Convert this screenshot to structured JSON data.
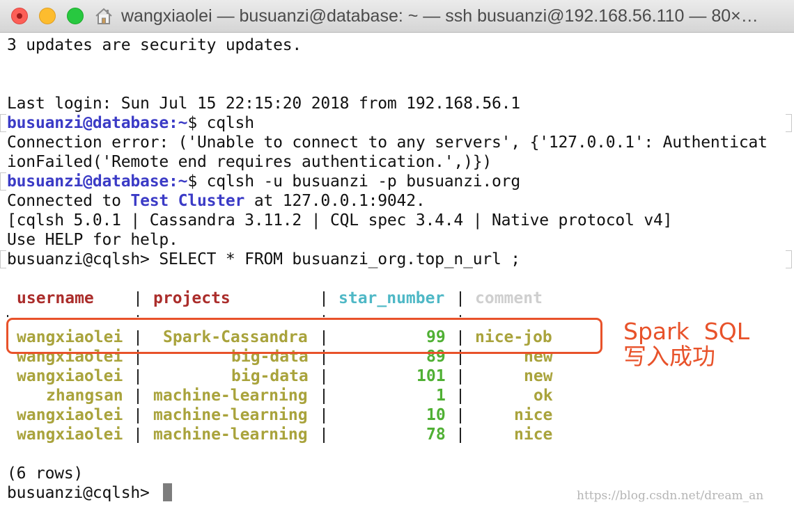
{
  "window": {
    "title": "wangxiaolei — busuanzi@database: ~ — ssh busuanzi@192.168.56.110 — 80×…"
  },
  "terminal": {
    "line_updates": "3 updates are security updates.",
    "line_last_login": "Last login: Sun Jul 15 22:15:20 2018 from 192.168.56.1",
    "prompt1_user": "busuanzi@database",
    "prompt1_path": ":~",
    "prompt1_cmd": "$ cqlsh",
    "error_line1": "Connection error: ('Unable to connect to any servers', {'127.0.0.1': Authenticat",
    "error_line2": "ionFailed('Remote end requires authentication.',)})",
    "prompt2_user": "busuanzi@database",
    "prompt2_path": ":~",
    "prompt2_cmd": "$ cqlsh -u busuanzi -p busuanzi.org",
    "connected_prefix": "Connected to ",
    "cluster_name": "Test Cluster",
    "connected_suffix": " at 127.0.0.1:9042.",
    "version_line": "[cqlsh 5.0.1 | Cassandra 3.11.2 | CQL spec 3.4.4 | Native protocol v4]",
    "help_line": "Use HELP for help.",
    "query_line": "busuanzi@cqlsh> SELECT * FROM busuanzi_org.top_n_url ;",
    "rows_line": "(6 rows)",
    "final_prompt": "busuanzi@cqlsh> "
  },
  "table": {
    "headers": [
      "username",
      "projects",
      "star_number",
      "comment"
    ],
    "rows": [
      [
        "wangxiaolei",
        "Spark-Cassandra",
        "99",
        "nice-job"
      ],
      [
        "wangxiaolei",
        "big-data",
        "89",
        "new"
      ],
      [
        "wangxiaolei",
        "big-data",
        "101",
        "new"
      ],
      [
        "zhangsan",
        "machine-learning",
        "1",
        "ok"
      ],
      [
        "wangxiaolei",
        "machine-learning",
        "10",
        "nice"
      ],
      [
        "wangxiaolei",
        "machine-learning",
        "78",
        "nice"
      ]
    ]
  },
  "annotation": {
    "line1": "Spark  SQL",
    "line2": "写入成功",
    "color": "#e8522a"
  },
  "watermark": "https://blog.csdn.net/dream_an",
  "colors": {
    "prompt": "#3b3bc6",
    "header_key": "#ab2d2b",
    "header_star": "#4fb8c6",
    "header_comment": "#cfcfcf",
    "text_cells": "#a9a33c",
    "number_cells": "#50b034"
  },
  "icons": [
    "close-light",
    "minimize-light",
    "maximize-light",
    "home-icon",
    "cursor-block"
  ]
}
